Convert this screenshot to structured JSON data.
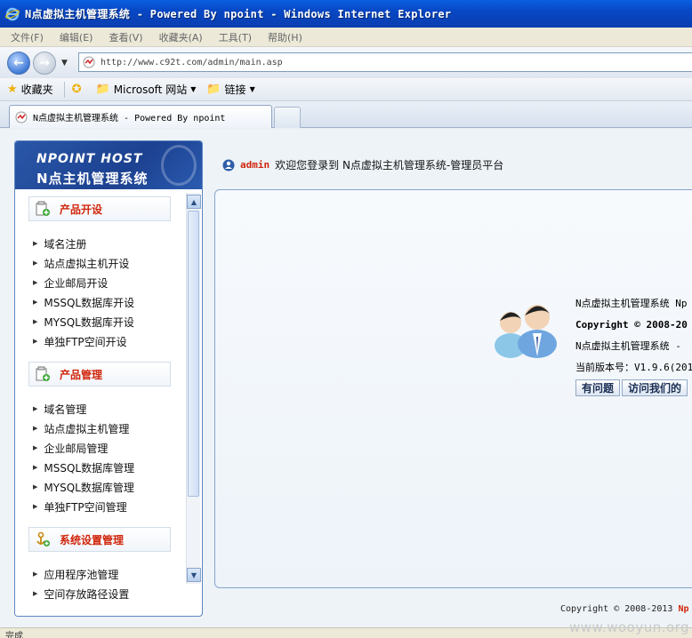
{
  "window": {
    "title": "N点虚拟主机管理系统 - Powered By npoint - Windows Internet Explorer"
  },
  "menubar": {
    "items": [
      "文件(F)",
      "编辑(E)",
      "查看(V)",
      "收藏夹(A)",
      "工具(T)",
      "帮助(H)"
    ]
  },
  "address": {
    "url": "http://www.c92t.com/admin/main.asp"
  },
  "favorites_bar": {
    "favorites_label": "收藏夹",
    "microsoft_sites": "Microsoft 网站",
    "links": "链接"
  },
  "tab": {
    "label": "N点虚拟主机管理系统 - Powered By npoint"
  },
  "logo": {
    "line1": "NPOINT HOST",
    "line2": "N点主机管理系统"
  },
  "sidebar": {
    "sections": [
      {
        "title": "产品开设",
        "items": [
          "域名注册",
          "站点虚拟主机开设",
          "企业邮局开设",
          "MSSQL数据库开设",
          "MYSQL数据库开设",
          "单独FTP空间开设"
        ]
      },
      {
        "title": "产品管理",
        "items": [
          "域名管理",
          "站点虚拟主机管理",
          "企业邮局管理",
          "MSSQL数据库管理",
          "MYSQL数据库管理",
          "单独FTP空间管理"
        ]
      },
      {
        "title": "系统设置管理",
        "items": [
          "应用程序池管理",
          "空间存放路径设置"
        ]
      }
    ]
  },
  "header": {
    "user": "admin",
    "welcome": "欢迎您登录到 N点虚拟主机管理系统-管理员平台"
  },
  "info": {
    "line1": "N点虚拟主机管理系统 Np",
    "line2": "Copyright © 2008-20",
    "line3": "N点虚拟主机管理系统 -",
    "line4": "当前版本号：V1.9.6(201",
    "button_question": "有问题",
    "button_visit": "访问我们的"
  },
  "footer": {
    "copyright": "Copyright © 2008-2013 ",
    "brand": "Np"
  },
  "status": {
    "text": "完成"
  },
  "watermark": {
    "text": "www.wooyun.org"
  }
}
